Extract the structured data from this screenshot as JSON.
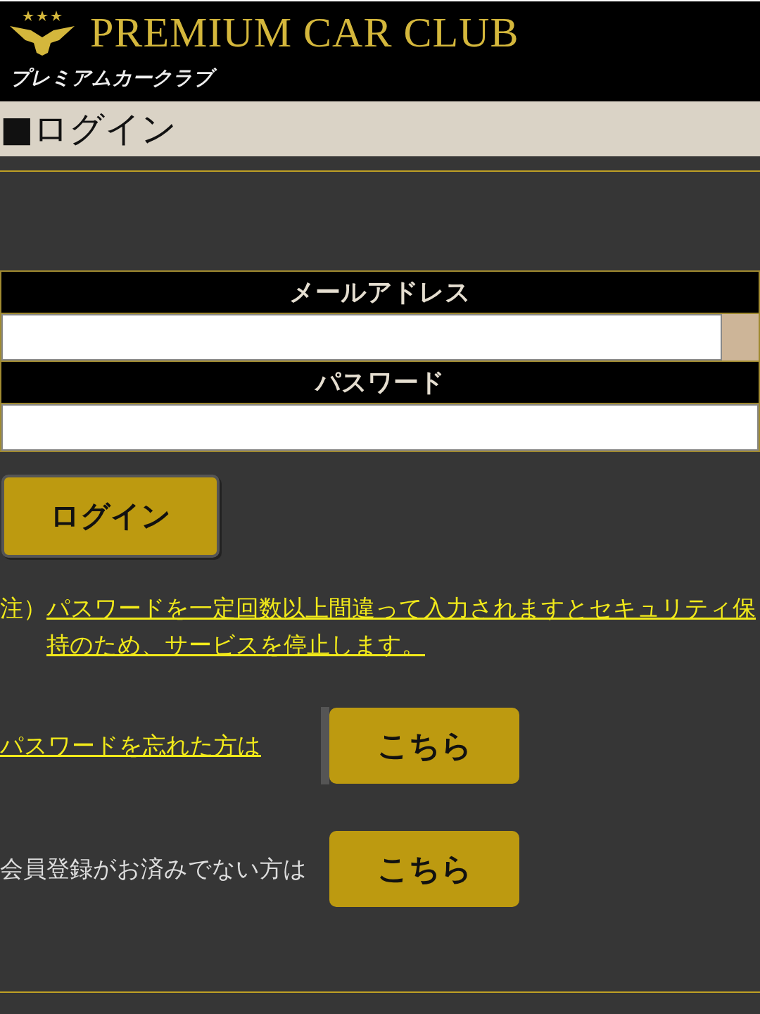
{
  "header": {
    "brand": "PREMIUM CAR CLUB",
    "brand_kana": "プレミアムカークラブ"
  },
  "page_title": "■ログイン",
  "form": {
    "fields": [
      {
        "label": "メールアドレス",
        "kind": "email"
      },
      {
        "label": "パスワード",
        "kind": "password"
      }
    ],
    "submit": "ログイン"
  },
  "notice": {
    "prefix": "注）",
    "text": "パスワードを一定回数以上間違って入力されますとセキュリティ保持のため、サービスを停止します。"
  },
  "links": [
    {
      "kind": "link",
      "label": "パスワードを忘れた方は",
      "button": "こちら"
    },
    {
      "kind": "text",
      "label": "会員登録がお済みでない方は",
      "button": "こちら"
    }
  ]
}
